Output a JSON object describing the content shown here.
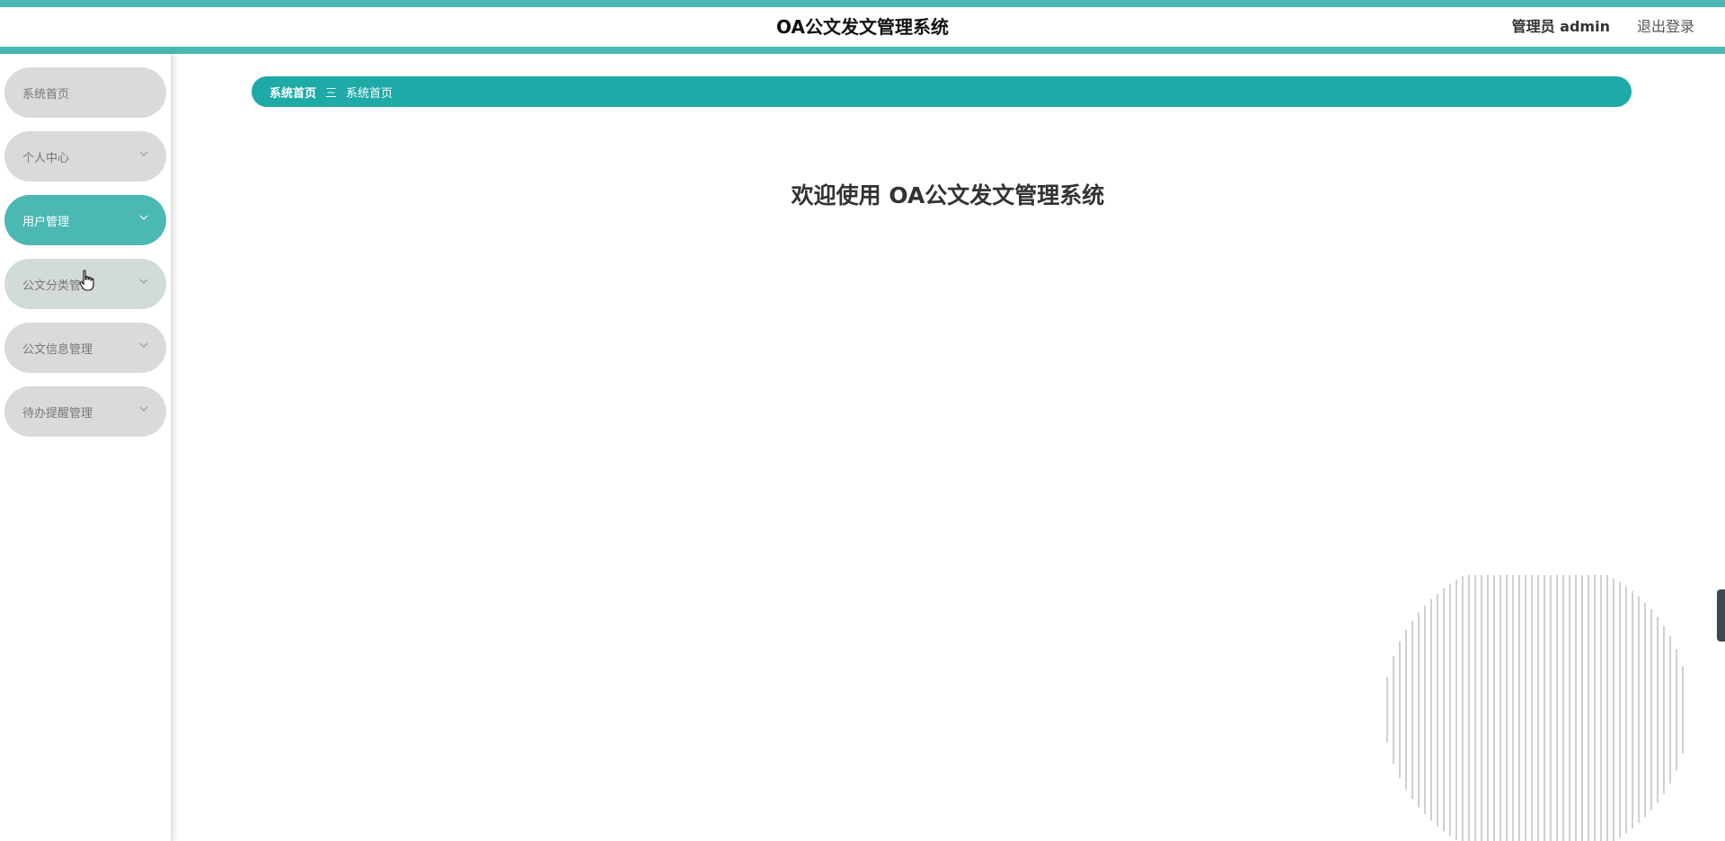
{
  "header": {
    "title": "OA公文发文管理系统",
    "user_label": "管理员 admin",
    "logout_label": "退出登录"
  },
  "sidebar": {
    "items": [
      {
        "label": "系统首页",
        "has_chevron": false
      },
      {
        "label": "个人中心",
        "has_chevron": true
      },
      {
        "label": "用户管理",
        "has_chevron": true,
        "active": true
      },
      {
        "label": "公文分类管理",
        "has_chevron": true
      },
      {
        "label": "公文信息管理",
        "has_chevron": true
      },
      {
        "label": "待办提醒管理",
        "has_chevron": true
      }
    ]
  },
  "breadcrumb": {
    "home": "系统首页",
    "separator": "三",
    "current": "系统首页"
  },
  "main": {
    "welcome": "欢迎使用 OA公文发文管理系统"
  },
  "colors": {
    "accent": "#4bb8b4",
    "breadcrumb_bg": "#1eaaa6",
    "menu_bg": "#dadada"
  },
  "icons": {
    "chevron": "chevron-down-icon",
    "cursor": "hand-pointer-icon"
  }
}
